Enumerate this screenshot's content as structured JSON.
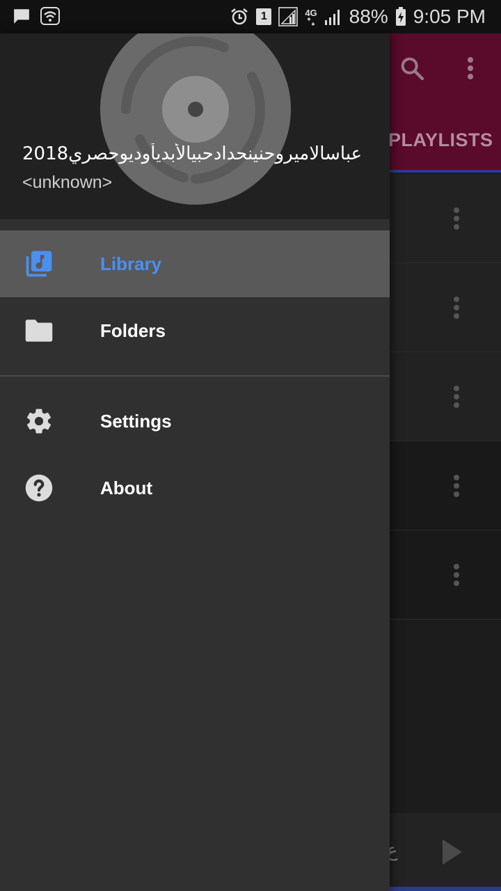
{
  "status_bar": {
    "battery_percent": "88%",
    "time": "9:05 PM",
    "sim_slot": "1",
    "network_type": "4G"
  },
  "background_app": {
    "tab_label": "PLAYLISTS",
    "mini_player_title": "ع",
    "colors": {
      "appbar": "#5a0a2a",
      "tab_indicator": "#2a3c8c"
    }
  },
  "drawer": {
    "header": {
      "title": "عباسالاميروحنينحدادحبيالأبديأوديوحصري2018",
      "subtitle": "<unknown>"
    },
    "items": [
      {
        "label": "Library",
        "icon": "library-music-icon",
        "active": true
      },
      {
        "label": "Folders",
        "icon": "folder-icon",
        "active": false
      }
    ],
    "secondary_items": [
      {
        "label": "Settings",
        "icon": "gear-icon"
      },
      {
        "label": "About",
        "icon": "help-icon"
      }
    ],
    "colors": {
      "active_text": "#4a90f0",
      "active_bg": "#595959"
    }
  }
}
